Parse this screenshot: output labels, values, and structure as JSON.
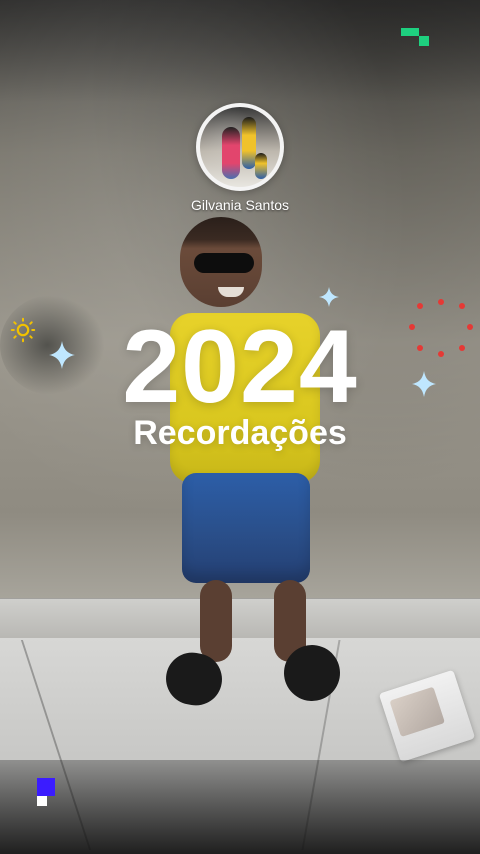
{
  "profile": {
    "name": "Gilvania Santos"
  },
  "story": {
    "year": "2024",
    "title": "Recordações"
  },
  "decor": {
    "top_right_pixel_color": "#1ed07f",
    "bottom_left_pixel_color": "#3b1cff",
    "sparkle_color": "#bfe7ff",
    "sun_color": "#f2c200",
    "fireworks_color": "#e53935",
    "icons": [
      "pixel-corner-icon",
      "sparkle-icon",
      "sun-icon",
      "fireworks-icon",
      "pixel-corner-icon"
    ]
  }
}
